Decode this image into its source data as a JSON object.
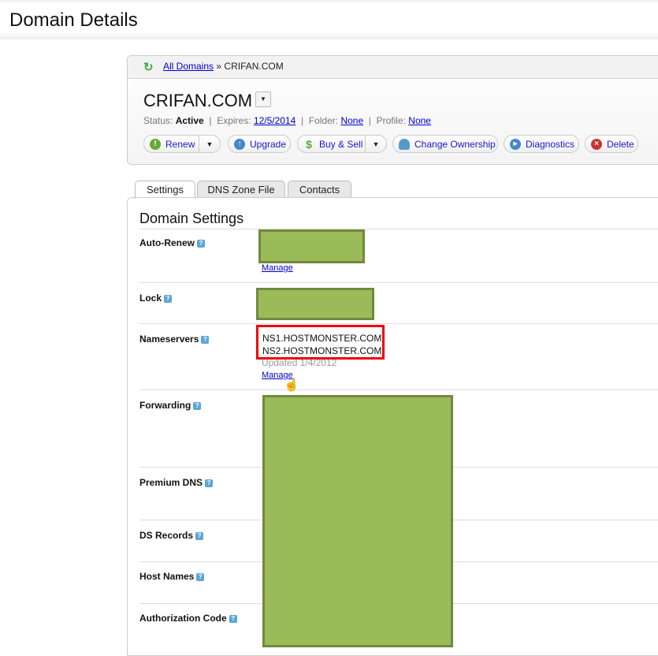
{
  "page_title": "Domain Details",
  "breadcrumb": {
    "link": "All Domains",
    "separator": "»",
    "current": "CRIFAN.COM"
  },
  "domain": {
    "name": "CRIFAN.COM",
    "status_label": "Status:",
    "status": "Active",
    "expires_label": "Expires:",
    "expires": "12/5/2014",
    "folder_label": "Folder:",
    "folder": "None",
    "profile_label": "Profile:",
    "profile": "None"
  },
  "actions": [
    "Renew",
    "Upgrade",
    "Buy & Sell",
    "Change Ownership",
    "Diagnostics",
    "Delete"
  ],
  "tabs": [
    "Settings",
    "DNS Zone File",
    "Contacts"
  ],
  "section_title": "Domain Settings",
  "settings": [
    "Auto-Renew",
    "Lock",
    "Nameservers",
    "Forwarding",
    "Premium DNS",
    "DS Records",
    "Host Names",
    "Authorization Code"
  ],
  "manage_label": "Manage",
  "nameservers": [
    "NS1.HOSTMONSTER.COM",
    "NS2.HOSTMONSTER.COM"
  ],
  "ns_updated": "Updated 1/4/2012"
}
